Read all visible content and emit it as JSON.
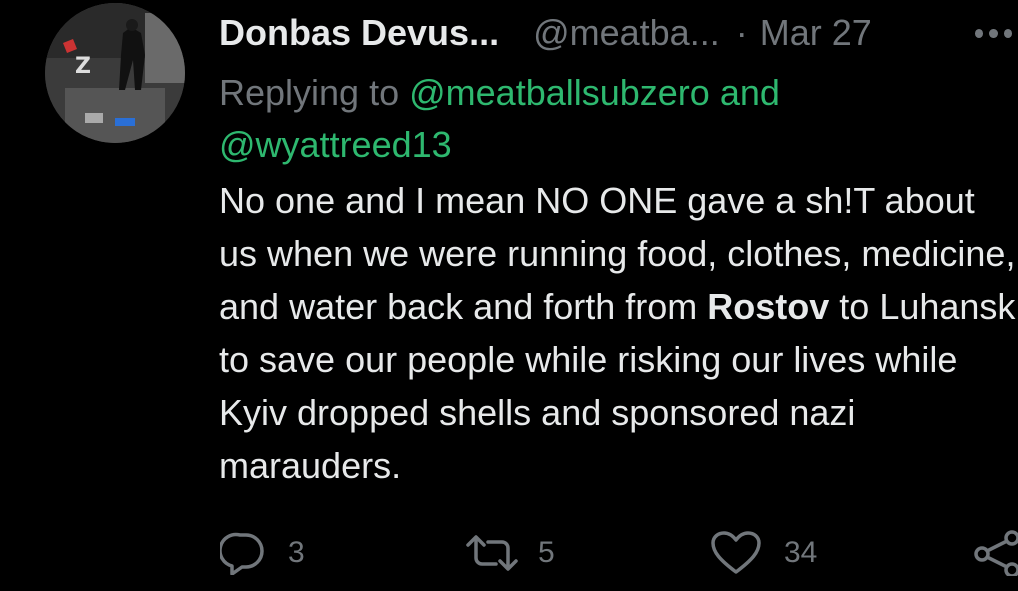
{
  "tweet": {
    "author_name": "Donbas Devus...",
    "handle": "@meatba...",
    "separator": "·",
    "date": "Mar 27",
    "reply_prefix": "Replying to",
    "reply_mention_1": "@meatballsubzero",
    "reply_and": "and",
    "reply_mention_2": "@wyattreed13",
    "text_part1": "No one and I mean NO ONE gave a sh!T about us when we were running food, clothes, medicine, and water back and forth from",
    "text_bold": "Rostov",
    "text_part2": "to Luhansk to save our people while risking our lives while Kyiv dropped shells and sponsored nazi marauders."
  },
  "actions": {
    "reply_count": "3",
    "retweet_count": "5",
    "like_count": "34"
  },
  "icons": {
    "reply": "reply-icon",
    "retweet": "retweet-icon",
    "like": "heart-icon",
    "share": "share-icon",
    "more": "more-options-icon"
  },
  "colors": {
    "background": "#000000",
    "text": "#e7e9ea",
    "secondary": "#71767b",
    "mention": "#2eb86f"
  }
}
